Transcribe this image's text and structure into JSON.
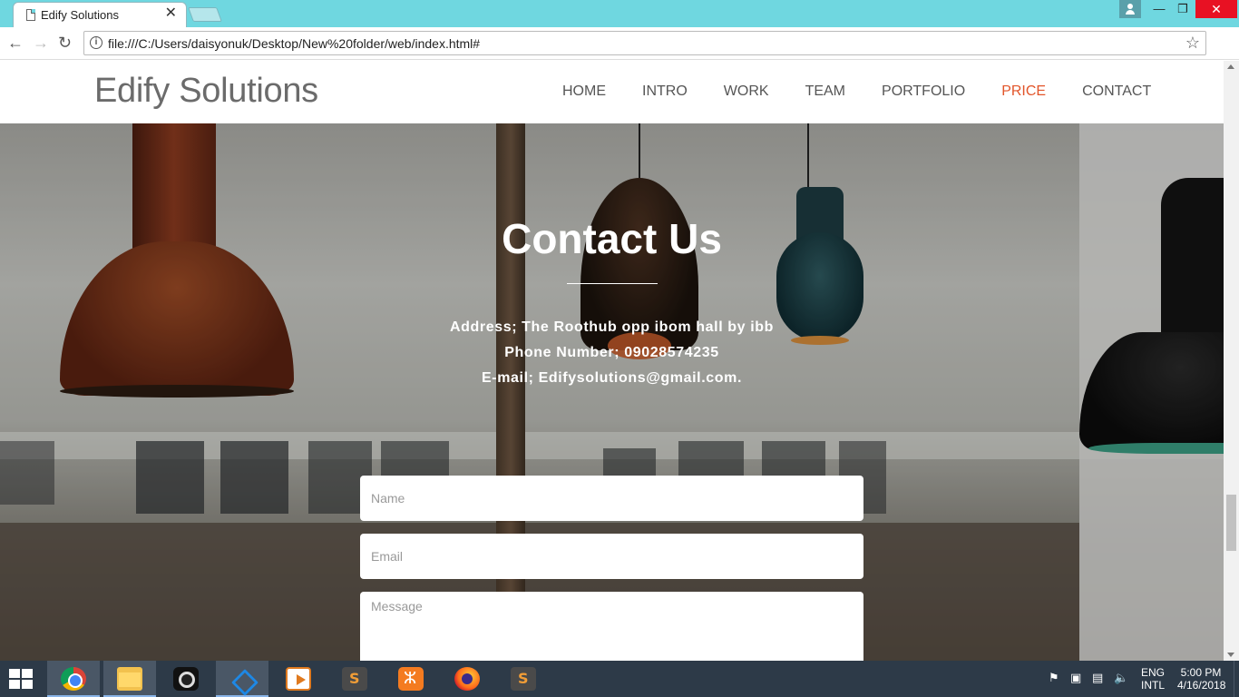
{
  "browser": {
    "tab_title": "Edify Solutions",
    "tab_close": "✕",
    "url": "file:///C:/Users/daisyonuk/Desktop/New%20folder/web/index.html#",
    "window_min": "—",
    "window_max": "❐",
    "window_close": "✕",
    "icons": {
      "back": "←",
      "forward": "→",
      "reload": "↻",
      "info": "i",
      "star": "☆"
    }
  },
  "site": {
    "brand": "Edify Solutions",
    "nav": [
      {
        "label": "HOME"
      },
      {
        "label": "INTRO"
      },
      {
        "label": "WORK"
      },
      {
        "label": "TEAM"
      },
      {
        "label": "PORTFOLIO"
      },
      {
        "label": "PRICE",
        "active": true
      },
      {
        "label": "CONTACT"
      }
    ],
    "nav_active_color": "#e2552a"
  },
  "contact": {
    "title": "Contact Us",
    "address": "Address; The Roothub opp ibom hall by ibb",
    "phone": "Phone Number; 09028574235",
    "email": "E-mail; Edifysolutions@gmail.com.",
    "form": {
      "name_placeholder": "Name",
      "email_placeholder": "Email",
      "message_placeholder": "Message"
    }
  },
  "taskbar": {
    "apps": [
      {
        "name": "chrome-icon",
        "active": true
      },
      {
        "name": "file-explorer-icon",
        "active": true
      },
      {
        "name": "camera-app-icon"
      },
      {
        "name": "visual-studio-code-icon",
        "active": true
      },
      {
        "name": "media-player-icon"
      },
      {
        "name": "sublime-text-icon"
      },
      {
        "name": "xampp-icon"
      },
      {
        "name": "firefox-icon"
      },
      {
        "name": "sublime-text-icon"
      }
    ],
    "language": "ENG",
    "layout": "INTL",
    "time": "5:00 PM",
    "date": "4/16/2018"
  }
}
